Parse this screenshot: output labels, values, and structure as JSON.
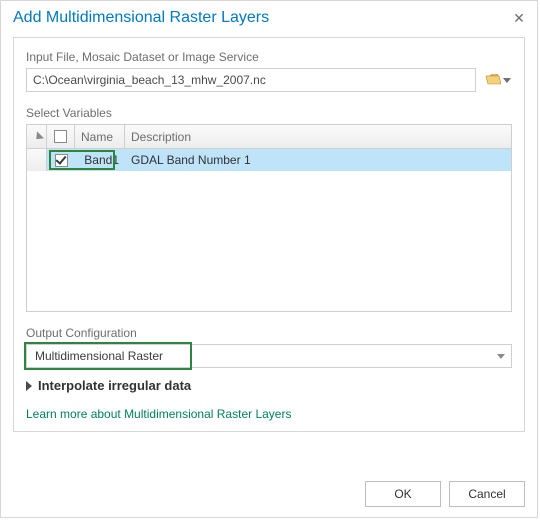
{
  "dialog": {
    "title": "Add Multidimensional Raster Layers"
  },
  "input": {
    "label": "Input File, Mosaic Dataset or Image Service",
    "value": "C:\\Ocean\\virginia_beach_13_mhw_2007.nc"
  },
  "variables": {
    "label": "Select Variables",
    "headers": {
      "name": "Name",
      "description": "Description"
    },
    "rows": [
      {
        "checked": true,
        "name": "Band1",
        "description": "GDAL Band Number 1"
      }
    ]
  },
  "output": {
    "label": "Output Configuration",
    "value": "Multidimensional Raster"
  },
  "expander": {
    "label": "Interpolate irregular data"
  },
  "link": {
    "text": "Learn more about Multidimensional Raster Layers"
  },
  "buttons": {
    "ok": "OK",
    "cancel": "Cancel"
  }
}
